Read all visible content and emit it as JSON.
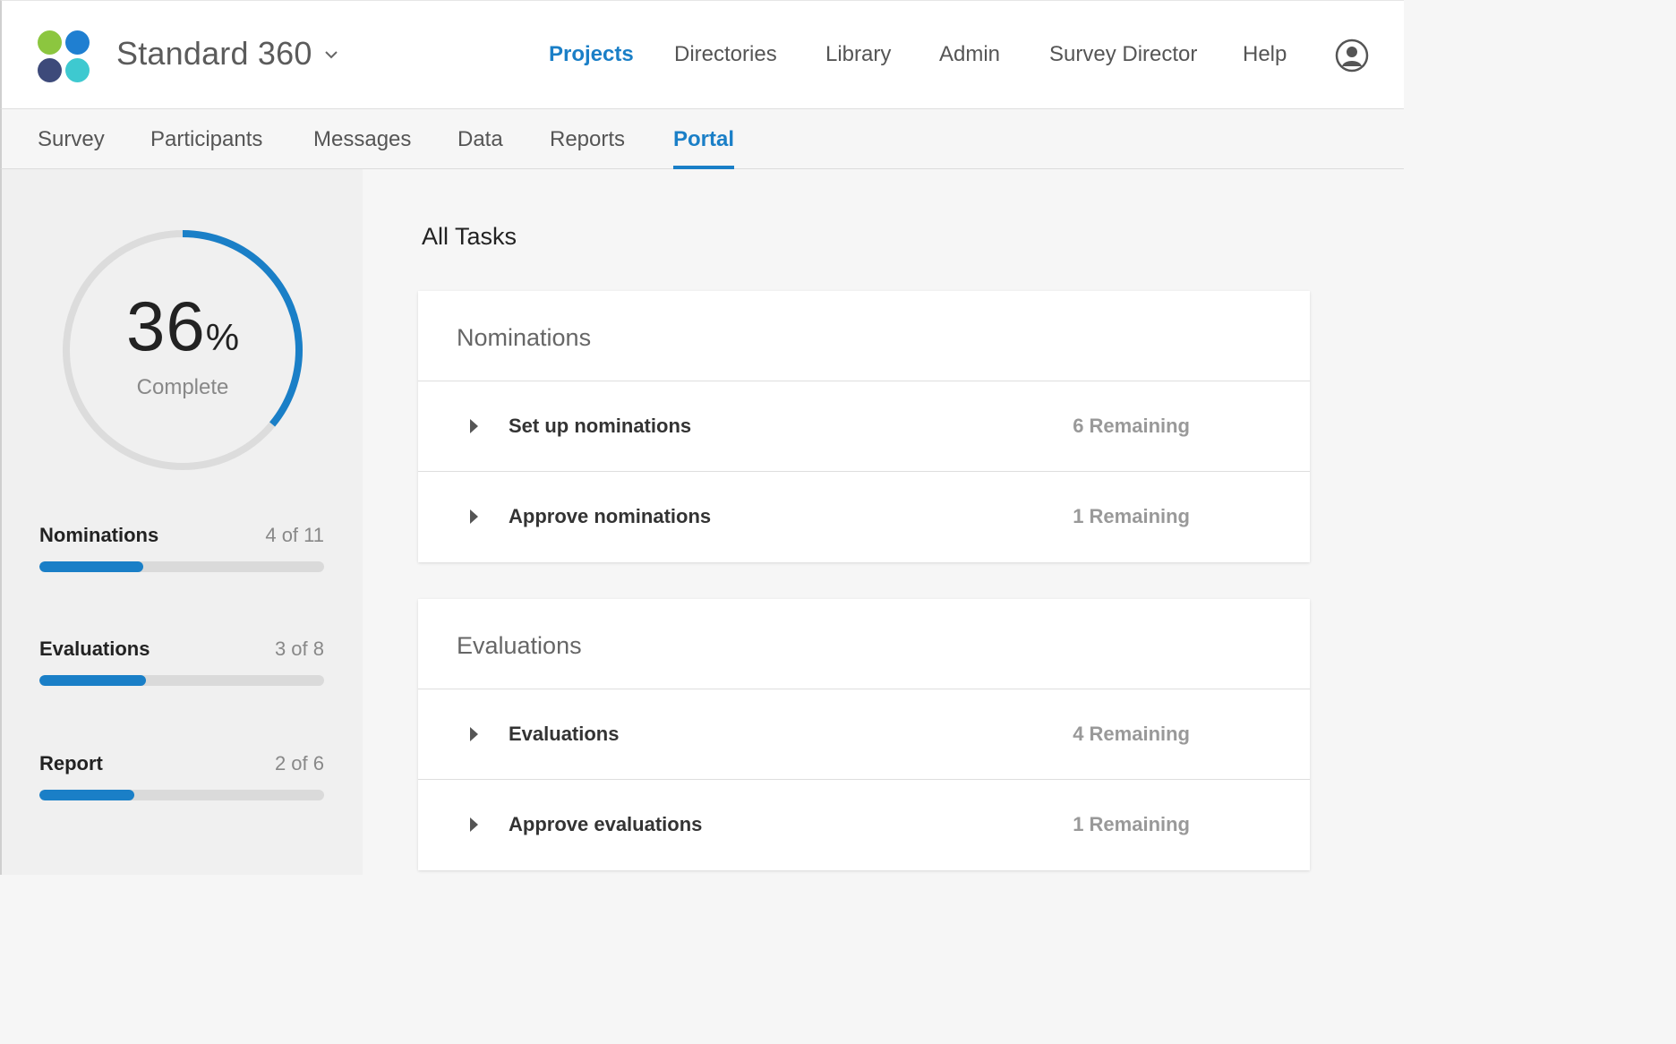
{
  "header": {
    "project_name": "Standard 360",
    "nav": [
      {
        "label": "Projects",
        "active": true
      },
      {
        "label": "Directories",
        "active": false
      },
      {
        "label": "Library",
        "active": false
      },
      {
        "label": "Admin",
        "active": false
      },
      {
        "label": "Survey Director",
        "active": false
      },
      {
        "label": "Help",
        "active": false
      }
    ],
    "logo_colors": [
      "#8cc63f",
      "#1f7fd1",
      "#3d4a7a",
      "#3ec9d0"
    ],
    "accent_color": "#1a7fc7"
  },
  "subnav": {
    "tabs": [
      {
        "label": "Survey",
        "active": false
      },
      {
        "label": "Participants",
        "active": false
      },
      {
        "label": "Messages",
        "active": false
      },
      {
        "label": "Data",
        "active": false
      },
      {
        "label": "Reports",
        "active": false
      },
      {
        "label": "Portal",
        "active": true
      }
    ]
  },
  "sidebar": {
    "overall": {
      "percent_number": "36",
      "percent_symbol": "%",
      "label": "Complete",
      "fraction": 0.36
    },
    "progress": [
      {
        "label": "Nominations",
        "count": "4 of 11",
        "done": 4,
        "total": 11
      },
      {
        "label": "Evaluations",
        "count": "3 of 8",
        "done": 3,
        "total": 8
      },
      {
        "label": "Report",
        "count": "2 of 6",
        "done": 2,
        "total": 6
      }
    ]
  },
  "main": {
    "title": "All Tasks",
    "cards": [
      {
        "title": "Nominations",
        "tasks": [
          {
            "name": "Set up nominations",
            "remaining": "6 Remaining"
          },
          {
            "name": "Approve nominations",
            "remaining": "1 Remaining"
          }
        ]
      },
      {
        "title": "Evaluations",
        "tasks": [
          {
            "name": "Evaluations",
            "remaining": "4 Remaining"
          },
          {
            "name": "Approve evaluations",
            "remaining": "1 Remaining"
          }
        ]
      }
    ]
  }
}
